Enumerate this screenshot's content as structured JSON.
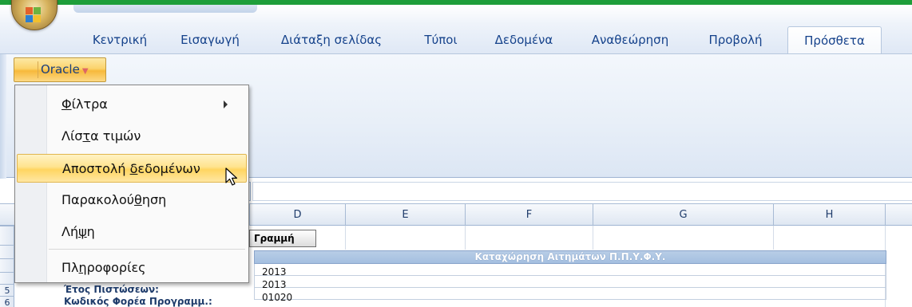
{
  "ribbon": {
    "tabs": [
      {
        "label": "Κεντρική"
      },
      {
        "label": "Εισαγωγή"
      },
      {
        "label": "Διάταξη σελίδας"
      },
      {
        "label": "Τύποι"
      },
      {
        "label": "Δεδομένα"
      },
      {
        "label": "Αναθεώρηση"
      },
      {
        "label": "Προβολή"
      },
      {
        "label": "Πρόσθετα"
      }
    ],
    "active_tab": "Πρόσθετα",
    "oracle_button": "Oracle"
  },
  "menu": {
    "items": [
      {
        "pre": "",
        "u": "Φ",
        "post": "ίλτρα",
        "has_submenu": true
      },
      {
        "pre": "Λίσ",
        "u": "τ",
        "post": "α τιμών",
        "has_submenu": false
      },
      {
        "pre": "Αποστολή ",
        "u": "δ",
        "post": "εδομένων",
        "has_submenu": false,
        "highlighted": true
      },
      {
        "pre": "Παρακολού",
        "u": "θ",
        "post": "ηση",
        "has_submenu": false
      },
      {
        "pre": "Λή",
        "u": "ψ",
        "post": "η",
        "has_submenu": false
      },
      {
        "pre": "Πλ",
        "u": "η",
        "post": "ροφορίες",
        "has_submenu": false
      }
    ]
  },
  "sheet": {
    "columns": [
      "D",
      "E",
      "F",
      "G",
      "H"
    ],
    "row_numbers": [
      "5",
      "6"
    ],
    "row_button": "Γραμμή",
    "title": "Καταχώρηση Αιτημάτων Π.Π.Υ.Φ.Υ.",
    "rows": [
      {
        "label": "",
        "value": "2013"
      },
      {
        "label": "Έτος Πιστώσεων:",
        "value": "2013"
      },
      {
        "label": "Κωδικός Φορέα Προγραμμ.:",
        "value": "01020"
      }
    ]
  },
  "colors": {
    "accent_green": "#1e9e3a",
    "tab_text": "#15428b",
    "highlight": "#ffd561"
  }
}
